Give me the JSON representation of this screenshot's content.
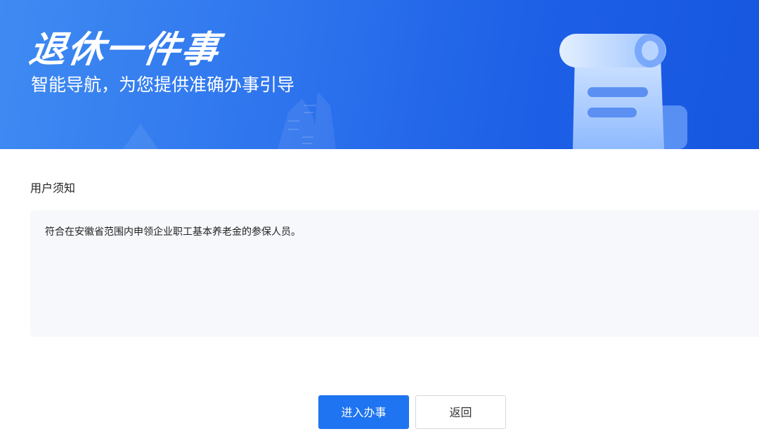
{
  "banner": {
    "title": "退休一件事",
    "subtitle": "智能导航，为您提供准确办事引导",
    "colors": {
      "start": "#3f8bf2",
      "end": "#1757e0"
    },
    "illustration": "scroll-document-icon"
  },
  "notice": {
    "label": "用户须知",
    "content": "符合在安徽省范围内申领企业职工基本养老金的参保人员。"
  },
  "actions": {
    "enter_label": "进入办事",
    "back_label": "返回",
    "primary_color": "#1e74f1"
  }
}
